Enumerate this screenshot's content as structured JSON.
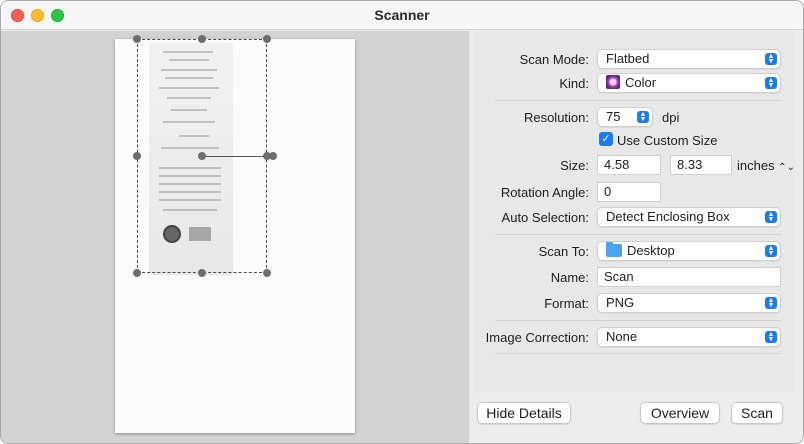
{
  "window": {
    "title": "Scanner"
  },
  "details": {
    "scan_mode": {
      "label": "Scan Mode:",
      "value": "Flatbed"
    },
    "kind": {
      "label": "Kind:",
      "value": "Color",
      "icon": "color-kind-icon"
    },
    "resolution": {
      "label": "Resolution:",
      "value": "75",
      "unit": "dpi"
    },
    "custom_size": {
      "label": "Use Custom Size",
      "checked": true
    },
    "size": {
      "label": "Size:",
      "width": "4.58",
      "height": "8.33",
      "unit": "inches"
    },
    "rotation": {
      "label": "Rotation Angle:",
      "value": "0"
    },
    "auto_selection": {
      "label": "Auto Selection:",
      "value": "Detect Enclosing Box"
    },
    "scan_to": {
      "label": "Scan To:",
      "value": "Desktop",
      "icon": "folder-icon"
    },
    "name": {
      "label": "Name:",
      "value": "Scan"
    },
    "format": {
      "label": "Format:",
      "value": "PNG"
    },
    "image_correction": {
      "label": "Image Correction:",
      "value": "None"
    }
  },
  "buttons": {
    "hide_details": "Hide Details",
    "overview": "Overview",
    "scan": "Scan"
  },
  "colors": {
    "accent": "#1a7cf5"
  }
}
